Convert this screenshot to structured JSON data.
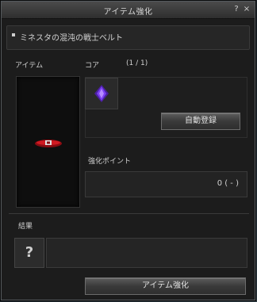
{
  "window": {
    "title": "アイテム強化",
    "help_label": "?",
    "close_label": "×"
  },
  "item": {
    "name": "ミネスタの混沌の戦士ベルト"
  },
  "labels": {
    "item": "アイテム",
    "core": "コア",
    "core_count": "(1 / 1)",
    "points": "強化ポイント",
    "result": "結果"
  },
  "buttons": {
    "auto_register": "自動登録",
    "enhance": "アイテム強化"
  },
  "points": {
    "value": "0 ( - )"
  },
  "result": {
    "placeholder": "?"
  },
  "icons": {
    "belt": "belt-icon",
    "core": "purple-crystal-icon"
  },
  "colors": {
    "gem": "#7b3ff2",
    "belt": "#c0141c"
  }
}
